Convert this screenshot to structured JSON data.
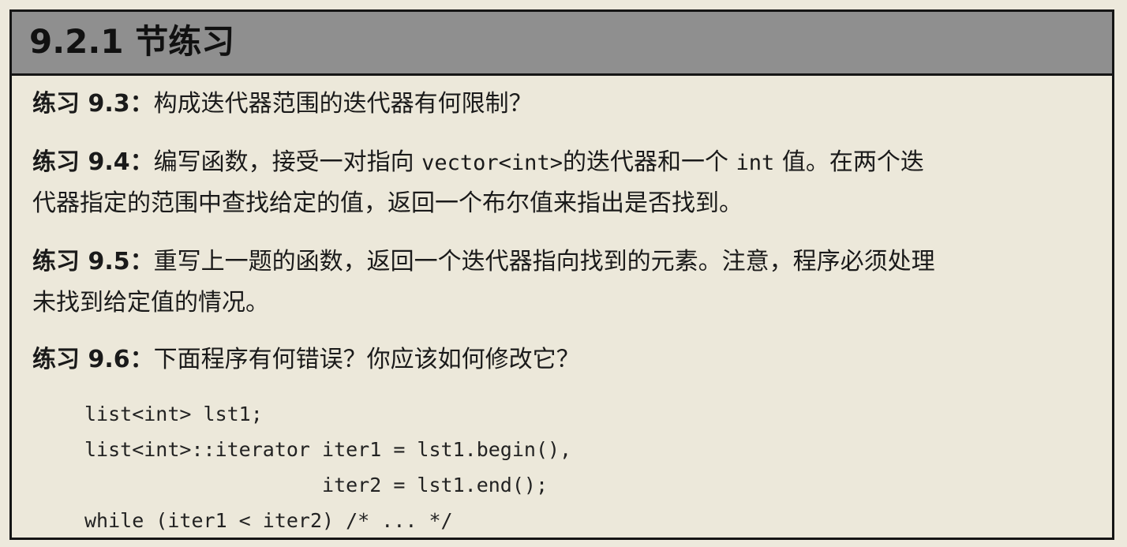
{
  "section": {
    "title": "9.2.1 节练习"
  },
  "exercises": [
    {
      "label": "练习 9.3：",
      "lines": [
        "构成迭代器范围的迭代器有何限制？"
      ]
    },
    {
      "label": "练习 9.4：",
      "line1_a": "编写函数，接受一对指向 ",
      "line1_code1": "vector<int>",
      "line1_b": "的迭代器和一个 ",
      "line1_code2": "int",
      "line1_c": " 值。在两个迭",
      "line2": "代器指定的范围中查找给定的值，返回一个布尔值来指出是否找到。"
    },
    {
      "label": "练习 9.5：",
      "line1": "重写上一题的函数，返回一个迭代器指向找到的元素。注意，程序必须处理",
      "line2": "未找到给定值的情况。"
    },
    {
      "label": "练习 9.6：",
      "line1": "下面程序有何错误？你应该如何修改它？"
    }
  ],
  "code": [
    "list<int> lst1;",
    "list<int>::iterator iter1 = lst1.begin(),",
    "                    iter2 = lst1.end();",
    "while (iter1 < iter2) /* ... */"
  ]
}
